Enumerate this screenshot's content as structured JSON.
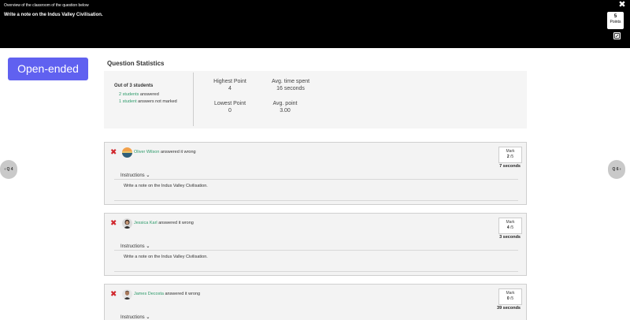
{
  "header": {
    "caption": "Overview of the classroom of the question below",
    "question": "Write a note on the Indus Valley Civilisation.",
    "close_icon": "close-icon",
    "points_value": "5",
    "points_label": "Points",
    "edit_icon": "edit-icon"
  },
  "question_type": "Open-ended",
  "stats": {
    "title": "Question Statistics",
    "out_of": "Out of 3 students",
    "answered_count": "2 students",
    "answered_text": "answered",
    "not_marked_count": "1 student",
    "not_marked_text": "answers not marked",
    "highest_label": "Highest Point",
    "highest_value": "4",
    "avg_time_label": "Avg. time spent",
    "avg_time_value": "16 seconds",
    "lowest_label": "Lowest Point",
    "lowest_value": "0",
    "avg_point_label": "Avg. point",
    "avg_point_value": "3.00"
  },
  "nav": {
    "prev": "Q 4",
    "next": "Q 6"
  },
  "answers": [
    {
      "name": "Oliver Wilson",
      "status": "answered it wrong",
      "mark_label": "Mark",
      "mark_value": "2",
      "mark_total": "/5",
      "time": "7 seconds",
      "instructions_label": "Instructions",
      "instructions_text": "Write a note on the Indus Valley Civilisation."
    },
    {
      "name": "Jessica Karl",
      "status": "answered it wrong",
      "mark_label": "Mark",
      "mark_value": "4",
      "mark_total": "/5",
      "time": "3 seconds",
      "instructions_label": "Instructions",
      "instructions_text": "Write a note on the Indus Valley Civilisation."
    },
    {
      "name": "James Decosta",
      "status": "answered it wrong",
      "mark_label": "Mark",
      "mark_value": "0",
      "mark_total": "/5",
      "time": "39 seconds",
      "instructions_label": "Instructions",
      "instructions_text": ""
    }
  ],
  "colors": {
    "header_bg": "#000000",
    "badge_bg": "#6061f0",
    "link_green": "#2e9a6a",
    "wrong_red": "#d0262c"
  }
}
